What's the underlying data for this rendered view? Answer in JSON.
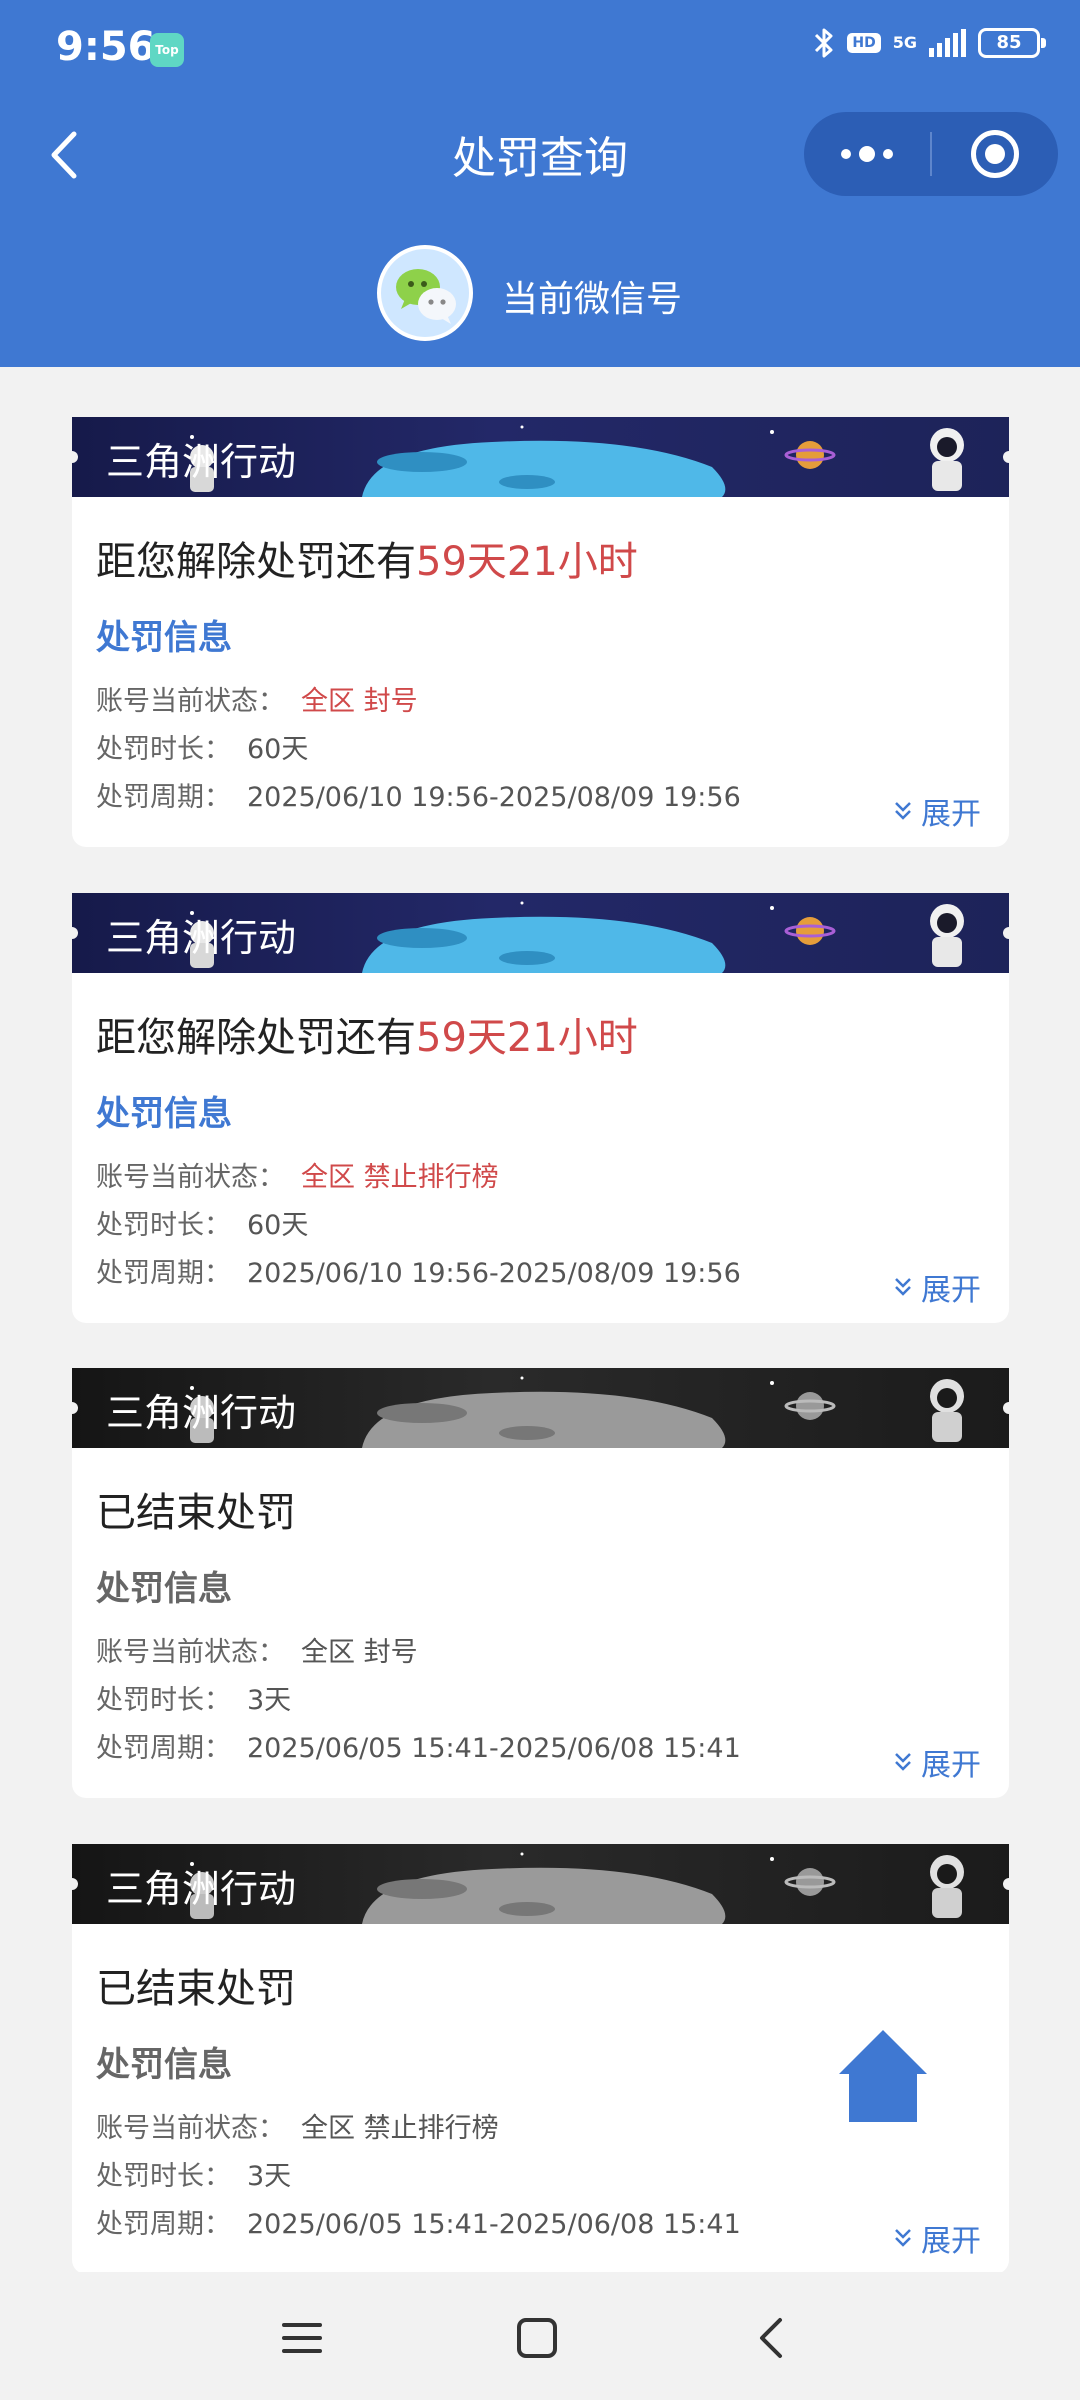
{
  "status_bar": {
    "time": "9:56",
    "app_badge": "Top",
    "hd": "HD",
    "network": "5G",
    "battery": "85",
    "signal_level": 4
  },
  "nav": {
    "title": "处罚查询",
    "colors": {
      "header": "#3f78d2",
      "capsule": "#2c5eb5"
    }
  },
  "account": {
    "label": "当前微信号",
    "avatar_icon": "wechat-icon"
  },
  "labels": {
    "section_title": "处罚信息",
    "status_label": "账号当前状态：",
    "duration_label": "处罚时长：",
    "period_label": "处罚周期：",
    "expand": "展开",
    "remain_prefix": "距您解除处罚还有",
    "game_title": "三角洲行动"
  },
  "records": [
    {
      "state": "active",
      "headline_prefix": "距您解除处罚还有",
      "remaining": "59天21小时",
      "status": "全区 封号",
      "duration": "60天",
      "period": "2025/06/10 19:56-2025/08/09 19:56"
    },
    {
      "state": "active",
      "headline_prefix": "距您解除处罚还有",
      "remaining": "59天21小时",
      "status": "全区 禁止排行榜",
      "duration": "60天",
      "period": "2025/06/10 19:56-2025/08/09 19:56"
    },
    {
      "state": "ended",
      "headline_prefix": "已结束处罚",
      "remaining": "",
      "status": "全区 封号",
      "duration": "3天",
      "period": "2025/06/05 15:41-2025/06/08 15:41"
    },
    {
      "state": "ended",
      "headline_prefix": "已结束处罚",
      "remaining": "",
      "status": "全区 禁止排行榜",
      "duration": "3天",
      "period": "2025/06/05 15:41-2025/06/08 15:41"
    }
  ],
  "colors": {
    "accent_blue": "#3f78d2",
    "alert_red": "#d0494a",
    "page_bg": "#f2f2f2"
  },
  "fab": {
    "icon": "home-icon"
  },
  "system_nav": {
    "menu_icon": "menu-icon",
    "home_icon": "square-home-icon",
    "back_icon": "back-icon"
  }
}
